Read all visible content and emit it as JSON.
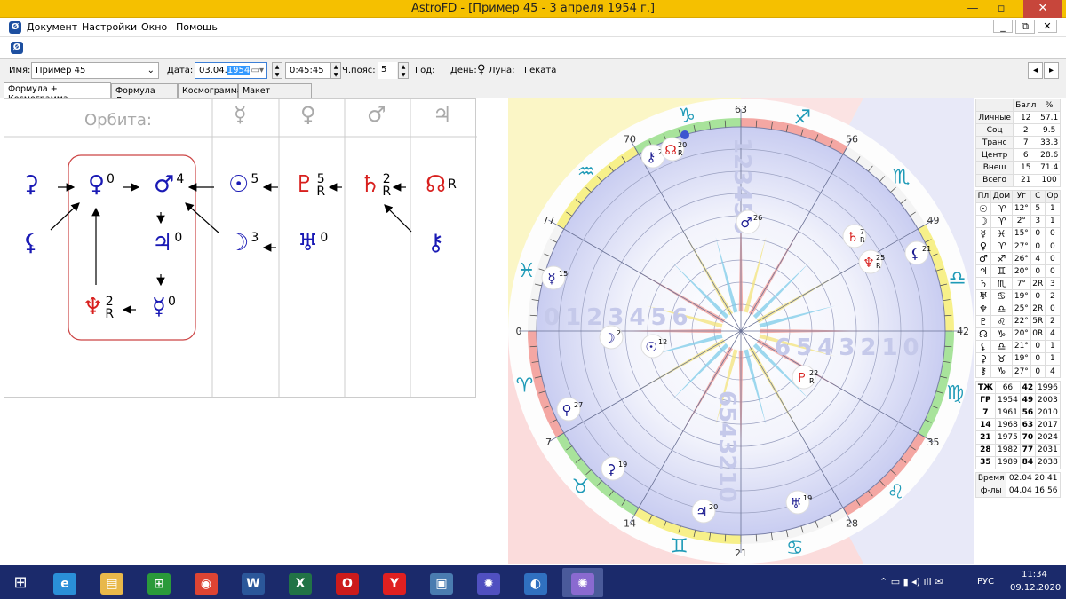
{
  "window": {
    "title": "AstroFD - [Пример 45 - 3 апреля 1954 г.]",
    "minimize": "—",
    "restore": "▫",
    "close": "✕",
    "mdi_min": "_",
    "mdi_restore": "⧉",
    "mdi_close": "✕"
  },
  "menu": [
    "Документ",
    "Настройки",
    "Окно",
    "Помощь"
  ],
  "form": {
    "name_label": "Имя:",
    "name_value": "Пример 45",
    "date_label": "Дата:",
    "date_day": "03.04.",
    "date_year": "1954",
    "time_value": "0:45:45",
    "tz_label": "Ч.пояс:",
    "tz_value": "5",
    "year_label": "Год:",
    "day_label": "День:",
    "day_glyph": "♀",
    "moon_label": "Луна:",
    "moon_value": "Геката",
    "prev": "◂",
    "next": "▸"
  },
  "tabs": [
    "Формула + Космограмма",
    "Формула Души",
    "Космограмма",
    "Макет страницы"
  ],
  "formula": {
    "orbit_label": "Орбита:",
    "columns": [
      "☿",
      "♀",
      "♂",
      "♃"
    ],
    "nodes": [
      {
        "g": "⚳",
        "sup": "",
        "red": false
      },
      {
        "g": "♀",
        "sup": "0",
        "red": false
      },
      {
        "g": "♂",
        "sup": "4",
        "red": false
      },
      {
        "g": "☉",
        "sup": "5",
        "red": false
      },
      {
        "g": "♇",
        "sup": "5",
        "sub": "R",
        "red": true
      },
      {
        "g": "♄",
        "sup": "2",
        "sub": "R",
        "red": true
      },
      {
        "g": "☊",
        "sup": "R",
        "red": true
      },
      {
        "g": "⚸",
        "sup": "",
        "red": false
      },
      {
        "g": "♃",
        "sup": "0",
        "red": false
      },
      {
        "g": "☽",
        "sup": "3",
        "red": false
      },
      {
        "g": "♅",
        "sup": "0",
        "red": false
      },
      {
        "g": "⚷",
        "sup": "",
        "red": false
      },
      {
        "g": "♆",
        "sup": "2",
        "sub": "R",
        "red": true
      },
      {
        "g": "☿",
        "sup": "0",
        "red": false
      }
    ]
  },
  "chart": {
    "colors": {
      "disk": "#c9cdf1",
      "red": "#f4a7a3",
      "green": "#a8e39b",
      "yellow": "#f7f08a",
      "sign": "#1e9ab7"
    },
    "signs": [
      "♈",
      "♉",
      "♊",
      "♋",
      "♌",
      "♍",
      "♎",
      "♏",
      "♐",
      "♑",
      "♒",
      "♓"
    ],
    "age_ticks": [
      "0",
      "7",
      "14",
      "21",
      "28",
      "35",
      "42",
      "49",
      "56",
      "63",
      "70",
      "77"
    ],
    "scale_left": "0123456",
    "scale_right": "6543210",
    "scale_top": "123456",
    "scale_bottom": "6543210",
    "planets": [
      {
        "g": "⚷",
        "deg": "27",
        "r": "",
        "red": false
      },
      {
        "g": "☊",
        "deg": "20",
        "r": "R",
        "red": true
      },
      {
        "g": "♂",
        "deg": "26",
        "r": "",
        "red": false
      },
      {
        "g": "♄",
        "deg": "7",
        "r": "R",
        "red": true
      },
      {
        "g": "♆",
        "deg": "25",
        "r": "R",
        "red": true
      },
      {
        "g": "⚸",
        "deg": "21",
        "r": "",
        "red": false
      },
      {
        "g": "☿",
        "deg": "15",
        "r": "",
        "red": false
      },
      {
        "g": "☽",
        "deg": "2",
        "r": "",
        "red": false
      },
      {
        "g": "☉",
        "deg": "12",
        "r": "",
        "red": false
      },
      {
        "g": "♇",
        "deg": "22",
        "r": "R",
        "red": true
      },
      {
        "g": "♀",
        "deg": "27",
        "r": "",
        "red": false
      },
      {
        "g": "⚳",
        "deg": "19",
        "r": "",
        "red": false
      },
      {
        "g": "♃",
        "deg": "20",
        "r": "",
        "red": false
      },
      {
        "g": "♅",
        "deg": "19",
        "r": "",
        "red": false
      }
    ]
  },
  "summary": {
    "headers": [
      "",
      "Балл",
      "%"
    ],
    "rows": [
      [
        "Личные",
        "12",
        "57.1"
      ],
      [
        "Соц",
        "2",
        "9.5"
      ],
      [
        "Транс",
        "7",
        "33.3"
      ],
      [
        "Центр",
        "6",
        "28.6"
      ],
      [
        "Внеш",
        "15",
        "71.4"
      ],
      [
        "Всего",
        "21",
        "100"
      ]
    ]
  },
  "planet_table": {
    "headers": [
      "Пл",
      "Дом",
      "Уг",
      "С",
      "Ор"
    ],
    "rows": [
      [
        "☉",
        "♈",
        "12°",
        "5",
        "1"
      ],
      [
        "☽",
        "♈",
        "2°",
        "3",
        "1"
      ],
      [
        "☿",
        "♓",
        "15°",
        "0",
        "0"
      ],
      [
        "♀",
        "♈",
        "27°",
        "0",
        "0"
      ],
      [
        "♂",
        "♐",
        "26°",
        "4",
        "0"
      ],
      [
        "♃",
        "♊",
        "20°",
        "0",
        "0"
      ],
      [
        "♄",
        "♏",
        "7°",
        "2R",
        "3"
      ],
      [
        "♅",
        "♋",
        "19°",
        "0",
        "2"
      ],
      [
        "♆",
        "♎",
        "25°",
        "2R",
        "0"
      ],
      [
        "♇",
        "♌",
        "22°",
        "5R",
        "2"
      ],
      [
        "☊",
        "♑",
        "20°",
        "0R",
        "4"
      ],
      [
        "⚸",
        "♎",
        "21°",
        "0",
        "1"
      ],
      [
        "⚳",
        "♉",
        "19°",
        "0",
        "1"
      ],
      [
        "⚷",
        "♑",
        "27°",
        "0",
        "4"
      ]
    ]
  },
  "years_table": {
    "rows": [
      [
        "ТЖ",
        "66",
        "42",
        "1996"
      ],
      [
        "ГР",
        "1954",
        "49",
        "2003"
      ],
      [
        "7",
        "1961",
        "56",
        "2010"
      ],
      [
        "14",
        "1968",
        "63",
        "2017"
      ],
      [
        "21",
        "1975",
        "70",
        "2024"
      ],
      [
        "28",
        "1982",
        "77",
        "2031"
      ],
      [
        "35",
        "1989",
        "84",
        "2038"
      ]
    ]
  },
  "time_table": {
    "rows": [
      [
        "Время",
        "02.04 20:41"
      ],
      [
        "ф-лы",
        "04.04 16:56"
      ]
    ]
  },
  "taskbar": {
    "apps": [
      {
        "name": "internet-explorer",
        "glyph": "e",
        "color": "#2a8fd8"
      },
      {
        "name": "file-explorer",
        "glyph": "▤",
        "color": "#e8b84a"
      },
      {
        "name": "store",
        "glyph": "⊞",
        "color": "#2a9a3a"
      },
      {
        "name": "chrome",
        "glyph": "◉",
        "color": "#dd4433"
      },
      {
        "name": "word",
        "glyph": "W",
        "color": "#2b579a"
      },
      {
        "name": "excel",
        "glyph": "X",
        "color": "#217346"
      },
      {
        "name": "opera",
        "glyph": "O",
        "color": "#cc1b1b"
      },
      {
        "name": "yandex-browser",
        "glyph": "Y",
        "color": "#e02020"
      },
      {
        "name": "photos",
        "glyph": "▣",
        "color": "#4a7cb0"
      },
      {
        "name": "settings",
        "glyph": "✹",
        "color": "#5050c0"
      },
      {
        "name": "app",
        "glyph": "◐",
        "color": "#3070c0"
      },
      {
        "name": "astrofd",
        "glyph": "✺",
        "color": "#8a6ad0"
      }
    ],
    "lang": "РУС",
    "time": "11:34",
    "date": "09.12.2020"
  }
}
